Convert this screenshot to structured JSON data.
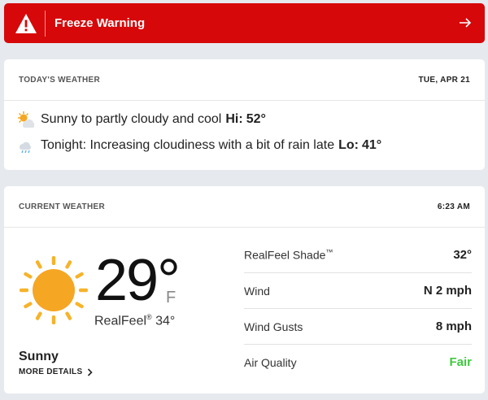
{
  "banner": {
    "title": "Freeze Warning",
    "color": "#d7080a"
  },
  "today": {
    "label": "TODAY'S WEATHER",
    "date": "TUE, APR 21",
    "day": {
      "icon": "partly-sunny-icon",
      "text": "Sunny to partly cloudy and cool",
      "hi_label": "Hi:",
      "hi_value": "52°"
    },
    "night": {
      "icon": "cloud-rain-icon",
      "text": "Tonight: Increasing cloudiness with a bit of rain late",
      "lo_label": "Lo:",
      "lo_value": "41°"
    }
  },
  "current": {
    "label": "CURRENT WEATHER",
    "time": "6:23 AM",
    "icon": "sun-icon",
    "temp": "29°",
    "unit": "F",
    "realfeel_label": "RealFeel",
    "realfeel_mark": "®",
    "realfeel_value": "34°",
    "condition": "Sunny",
    "more_details": "MORE DETAILS",
    "details": [
      {
        "label": "RealFeel Shade",
        "mark": "™",
        "value": "32°"
      },
      {
        "label": "Wind",
        "value": "N 2 mph"
      },
      {
        "label": "Wind Gusts",
        "value": "8 mph"
      },
      {
        "label": "Air Quality",
        "value": "Fair"
      }
    ],
    "fair_color": "#3ec93e"
  }
}
